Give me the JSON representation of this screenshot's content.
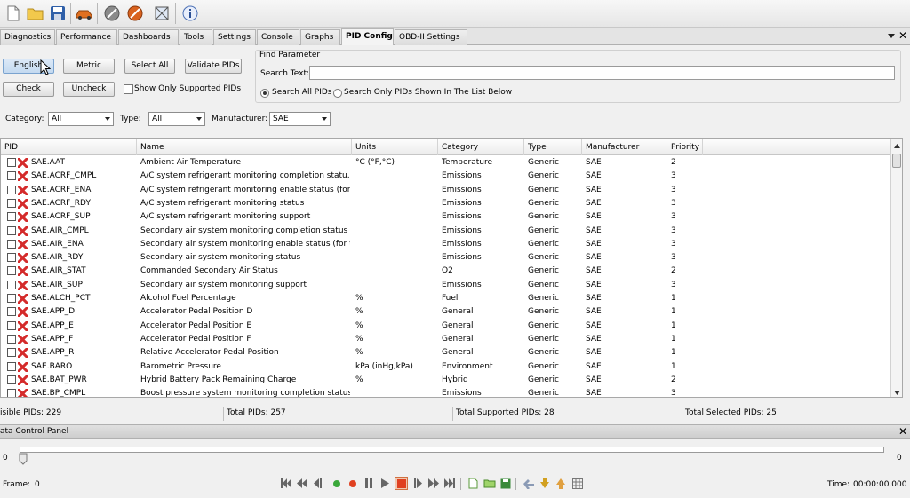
{
  "toolbar": {
    "icons": [
      "new-file-icon",
      "open-folder-icon",
      "save-icon",
      "vehicle-icon",
      "disconnect-icon",
      "connect-icon",
      "scan-icon",
      "info-icon"
    ]
  },
  "tabs": [
    {
      "label": "Diagnostics",
      "active": false
    },
    {
      "label": "Performance",
      "active": false
    },
    {
      "label": "Dashboards",
      "active": false
    },
    {
      "label": "Tools",
      "active": false
    },
    {
      "label": "Settings",
      "active": false
    },
    {
      "label": "Console",
      "active": false
    },
    {
      "label": "Graphs",
      "active": false
    },
    {
      "label": "PID Config",
      "active": true
    },
    {
      "label": "OBD-II Settings",
      "active": false
    }
  ],
  "controls": {
    "english_label": "English",
    "metric_label": "Metric",
    "select_all_label": "Select All",
    "validate_label": "Validate PIDs",
    "check_label": "Check",
    "uncheck_label": "Uncheck",
    "supported_only_label": "Show Only Supported PIDs",
    "category_label": "Category:",
    "category_value": "All",
    "type_label": "Type:",
    "type_value": "All",
    "manufacturer_label": "Manufacturer:",
    "manufacturer_value": "SAE"
  },
  "find": {
    "title": "Find Parameter",
    "search_label": "Search Text:",
    "search_value": "",
    "radio_all": "Search All PIDs",
    "radio_shown": "Search Only PIDs Shown In The List Below"
  },
  "table": {
    "columns": [
      "PID",
      "Name",
      "Units",
      "Category",
      "Type",
      "Manufacturer",
      "Priority"
    ],
    "rows": [
      [
        "SAE.AAT",
        "Ambient Air Temperature",
        "°C  (°F,°C)",
        "Temperature",
        "Generic",
        "SAE",
        "2"
      ],
      [
        "SAE.ACRF_CMPL",
        "A/C system refrigerant monitoring completion statu...",
        "",
        "Emissions",
        "Generic",
        "SAE",
        "3"
      ],
      [
        "SAE.ACRF_ENA",
        "A/C system refrigerant monitoring enable status (for ...",
        "",
        "Emissions",
        "Generic",
        "SAE",
        "3"
      ],
      [
        "SAE.ACRF_RDY",
        "A/C system refrigerant monitoring status",
        "",
        "Emissions",
        "Generic",
        "SAE",
        "3"
      ],
      [
        "SAE.ACRF_SUP",
        "A/C system refrigerant monitoring support",
        "",
        "Emissions",
        "Generic",
        "SAE",
        "3"
      ],
      [
        "SAE.AIR_CMPL",
        "Secondary air system monitoring completion status (...",
        "",
        "Emissions",
        "Generic",
        "SAE",
        "3"
      ],
      [
        "SAE.AIR_ENA",
        "Secondary air system monitoring enable status (for t...",
        "",
        "Emissions",
        "Generic",
        "SAE",
        "3"
      ],
      [
        "SAE.AIR_RDY",
        "Secondary air system monitoring status",
        "",
        "Emissions",
        "Generic",
        "SAE",
        "3"
      ],
      [
        "SAE.AIR_STAT",
        "Commanded Secondary Air Status",
        "",
        "O2",
        "Generic",
        "SAE",
        "2"
      ],
      [
        "SAE.AIR_SUP",
        "Secondary air system monitoring support",
        "",
        "Emissions",
        "Generic",
        "SAE",
        "3"
      ],
      [
        "SAE.ALCH_PCT",
        "Alcohol Fuel Percentage",
        "%",
        "Fuel",
        "Generic",
        "SAE",
        "1"
      ],
      [
        "SAE.APP_D",
        "Accelerator Pedal Position D",
        "%",
        "General",
        "Generic",
        "SAE",
        "1"
      ],
      [
        "SAE.APP_E",
        "Accelerator Pedal Position E",
        "%",
        "General",
        "Generic",
        "SAE",
        "1"
      ],
      [
        "SAE.APP_F",
        "Accelerator Pedal Position F",
        "%",
        "General",
        "Generic",
        "SAE",
        "1"
      ],
      [
        "SAE.APP_R",
        "Relative Accelerator Pedal Position",
        "%",
        "General",
        "Generic",
        "SAE",
        "1"
      ],
      [
        "SAE.BARO",
        "Barometric Pressure",
        "kPa  (inHg,kPa)",
        "Environment",
        "Generic",
        "SAE",
        "1"
      ],
      [
        "SAE.BAT_PWR",
        "Hybrid Battery Pack Remaining Charge",
        "%",
        "Hybrid",
        "Generic",
        "SAE",
        "2"
      ],
      [
        "SAE.BP_CMPL",
        "Boost pressure system monitoring completion status...",
        "",
        "Emissions",
        "Generic",
        "SAE",
        "3"
      ]
    ]
  },
  "status": {
    "visible": "isible PIDs: 229",
    "total": "Total PIDs: 257",
    "supported": "Total Supported PIDs: 28",
    "selected": "Total Selected PIDs: 25"
  },
  "dcp": {
    "title": "ata Control Panel",
    "slider_min": "0",
    "slider_max": "0",
    "slider_position": 0,
    "frame_label": "Frame:",
    "frame_value": "0",
    "time_label": "Time:",
    "time_value": "00:00:00.000"
  },
  "colors": {
    "accent": "#7aa3cf",
    "error_x": "#d42b2b",
    "record": "#e04020",
    "play_green": "#3aa83a"
  }
}
